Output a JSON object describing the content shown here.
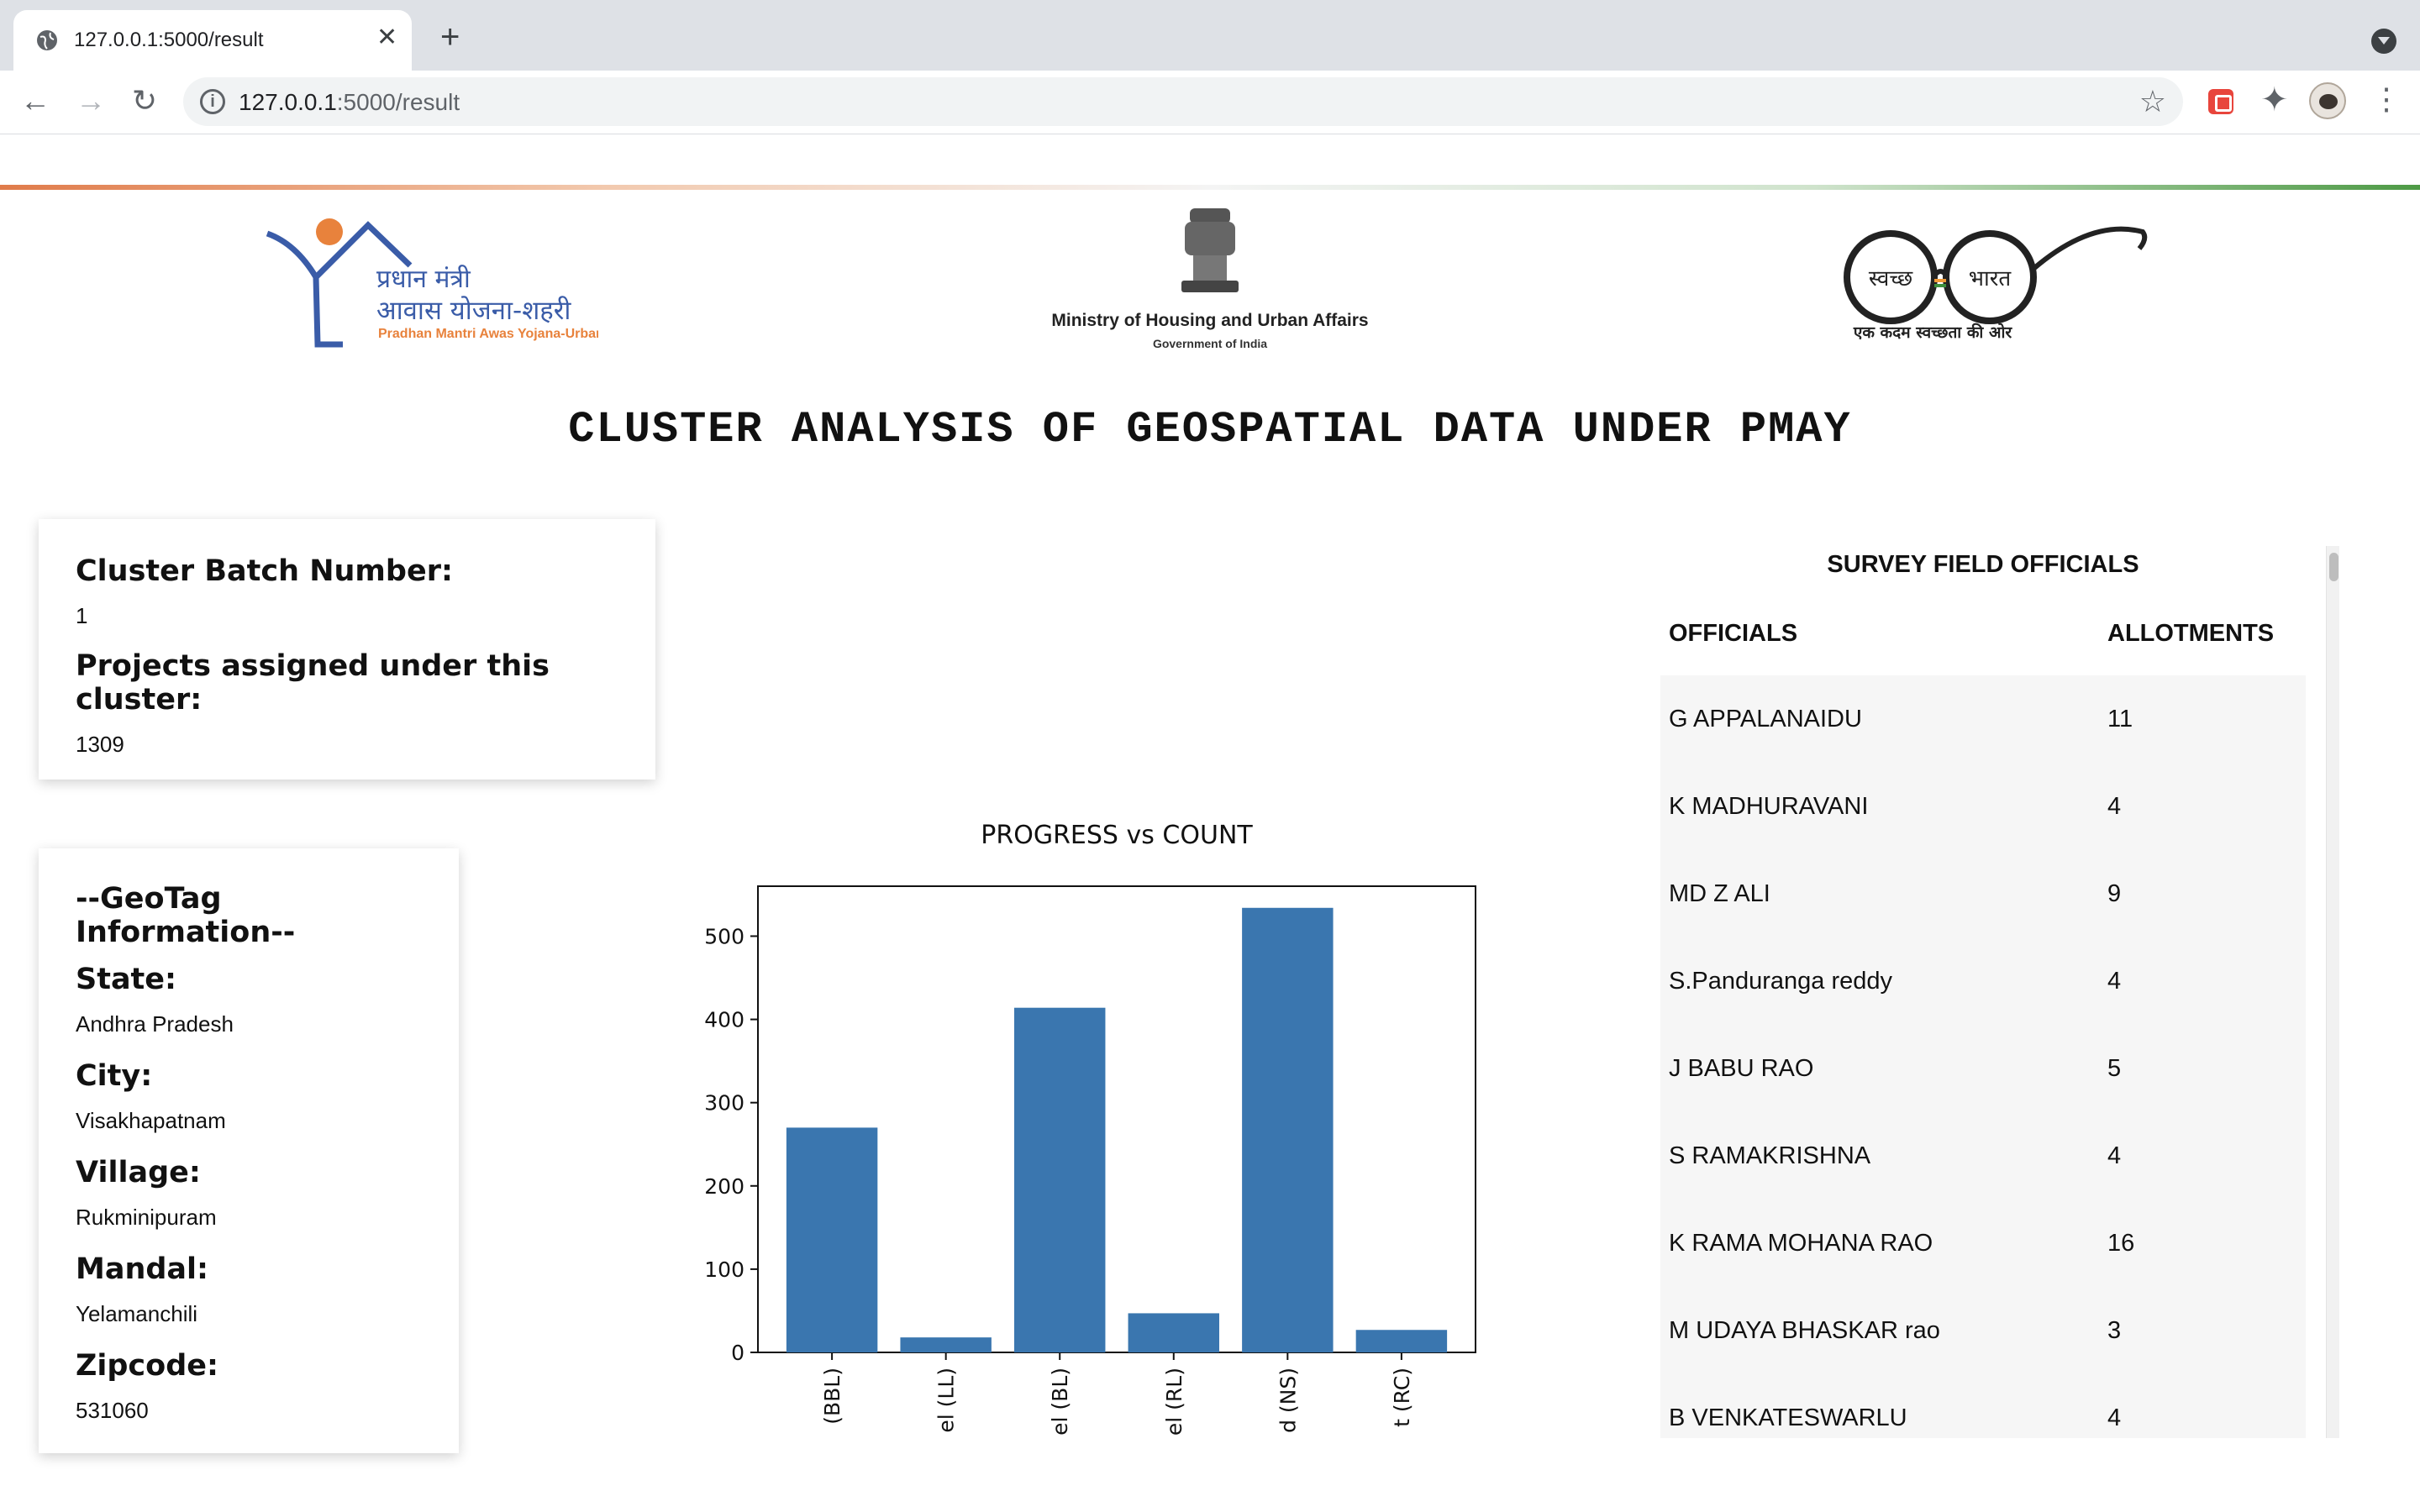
{
  "browser": {
    "tab_title": "127.0.0.1:5000/result",
    "url_host": "127.0.0.1",
    "url_path": ":5000/result"
  },
  "logos": {
    "pmay_hindi_1": "प्रधान मंत्री",
    "pmay_hindi_2": "आवास योजना-शहरी",
    "pmay_english": "Pradhan Mantri Awas Yojana-Urban",
    "ministry_name": "Ministry of Housing and Urban Affairs",
    "ministry_sub": "Government of India",
    "swachh_left": "स्वच्छ",
    "swachh_right": "भारत",
    "swachh_tagline": "एक कदम स्वच्छता की ओर"
  },
  "page_title": "CLUSTER ANALYSIS OF GEOSPATIAL DATA UNDER PMAY",
  "cluster": {
    "batch_label": "Cluster Batch Number:",
    "batch_value": "1",
    "projects_label": "Projects assigned under this cluster:",
    "projects_value": "1309"
  },
  "geotag": {
    "heading": "--GeoTag Information--",
    "state_label": "State:",
    "state_value": "Andhra Pradesh",
    "city_label": "City:",
    "city_value": "Visakhapatnam",
    "village_label": "Village:",
    "village_value": "Rukminipuram",
    "mandal_label": "Mandal:",
    "mandal_value": "Yelamanchili",
    "zipcode_label": "Zipcode:",
    "zipcode_value": "531060"
  },
  "chart_data": {
    "type": "bar",
    "title": "PROGRESS vs COUNT",
    "xlabel": "",
    "ylabel": "",
    "categories": [
      "(BBL)",
      "el (LL)",
      "el (BL)",
      "el (RL)",
      "d (NS)",
      "t (RC)"
    ],
    "values": [
      270,
      18,
      414,
      47,
      534,
      27
    ],
    "ylim": [
      0,
      560
    ],
    "yticks": [
      0,
      100,
      200,
      300,
      400,
      500
    ],
    "color": "#3a76af",
    "grid": false
  },
  "officials": {
    "title": "SURVEY FIELD OFFICIALS",
    "col_officials": "OFFICIALS",
    "col_allotments": "ALLOTMENTS",
    "rows": [
      {
        "name": "G APPALANAIDU",
        "allotments": "11"
      },
      {
        "name": "K MADHURAVANI",
        "allotments": "4"
      },
      {
        "name": "MD Z ALI",
        "allotments": "9"
      },
      {
        "name": "S.Panduranga reddy",
        "allotments": "4"
      },
      {
        "name": "J BABU RAO",
        "allotments": "5"
      },
      {
        "name": "S RAMAKRISHNA",
        "allotments": "4"
      },
      {
        "name": "K RAMA MOHANA RAO",
        "allotments": "16"
      },
      {
        "name": "M UDAYA BHASKAR rao",
        "allotments": "3"
      },
      {
        "name": "B VENKATESWARLU",
        "allotments": "4"
      }
    ]
  }
}
